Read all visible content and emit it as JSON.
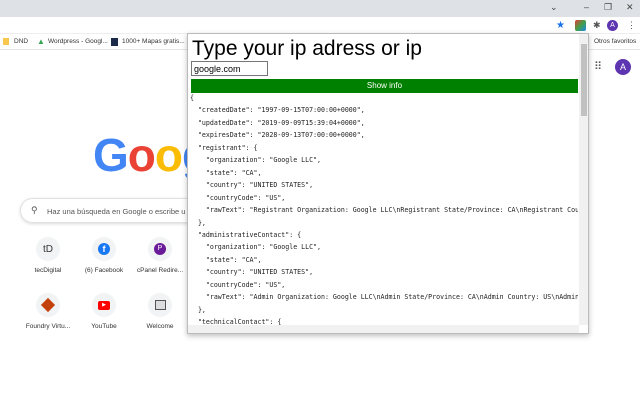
{
  "browser": {
    "bookmarks": [
      "DND",
      "Wordpress - Googl...",
      "1000+ Mapas gratis..."
    ],
    "other_bookmarks": "Otros favoritos",
    "profile_initial": "A"
  },
  "newtab": {
    "logo": "Google",
    "search_placeholder": "Haz una búsqueda en Google o escribe u",
    "shortcuts": [
      {
        "label": "tecDigital",
        "icon": "tD"
      },
      {
        "label": "(6) Facebook",
        "icon": "f"
      },
      {
        "label": "cPanel Redire...",
        "icon": "P"
      },
      {
        "label": "Foundry Virtu...",
        "icon": "foundry-icon"
      },
      {
        "label": "YouTube",
        "icon": "youtube-icon"
      },
      {
        "label": "Welcome",
        "icon": "welcome-icon"
      }
    ]
  },
  "popup": {
    "title": "Type your ip adress or ip",
    "input_value": "google.com",
    "button_label": "Show info",
    "accent": "#008000",
    "json_text": "{\n  \"createdDate\": \"1997-09-15T07:00:00+0000\",\n  \"updatedDate\": \"2019-09-09T15:39:04+0000\",\n  \"expiresDate\": \"2028-09-13T07:00:00+0000\",\n  \"registrant\": {\n    \"organization\": \"Google LLC\",\n    \"state\": \"CA\",\n    \"country\": \"UNITED STATES\",\n    \"countryCode\": \"US\",\n    \"rawText\": \"Registrant Organization: Google LLC\\nRegistrant State/Province: CA\\nRegistrant Country: US\\n\"\n  },\n  \"administrativeContact\": {\n    \"organization\": \"Google LLC\",\n    \"state\": \"CA\",\n    \"country\": \"UNITED STATES\",\n    \"countryCode\": \"US\",\n    \"rawText\": \"Admin Organization: Google LLC\\nAdmin State/Province: CA\\nAdmin Country: US\\nAdmin Em\"\n  },\n  \"technicalContact\": {\n    \"organization\": \"Google LLC\",\n    \"state\": \"CA\",\n    \"country\": \"UNITED STATES\","
  }
}
